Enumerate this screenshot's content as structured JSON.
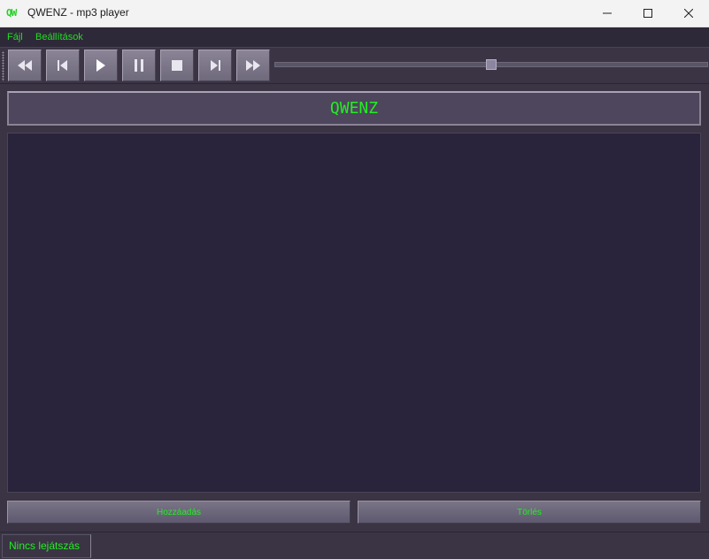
{
  "window": {
    "icon_text": "QW",
    "title": "QWENZ - mp3 player"
  },
  "menu": {
    "items": [
      {
        "label": "Fájl"
      },
      {
        "label": "Beállítások"
      }
    ]
  },
  "toolbar": {
    "buttons": [
      {
        "icon": "rewind-icon"
      },
      {
        "icon": "skip-previous-icon"
      },
      {
        "icon": "play-icon"
      },
      {
        "icon": "pause-icon"
      },
      {
        "icon": "stop-icon"
      },
      {
        "icon": "skip-next-icon"
      },
      {
        "icon": "fast-forward-icon"
      }
    ],
    "position_slider": {
      "value_fraction": 0.5
    }
  },
  "banner": {
    "text": "QWENZ"
  },
  "playlist": {
    "items": []
  },
  "actions": {
    "add_label": "Hozzáadás",
    "delete_label": "Törlés"
  },
  "status": {
    "text": "Nincs lejátszás"
  },
  "colors": {
    "accent_text": "#22ee22",
    "background": "#3a3444",
    "playlist_bg": "#29233b"
  }
}
